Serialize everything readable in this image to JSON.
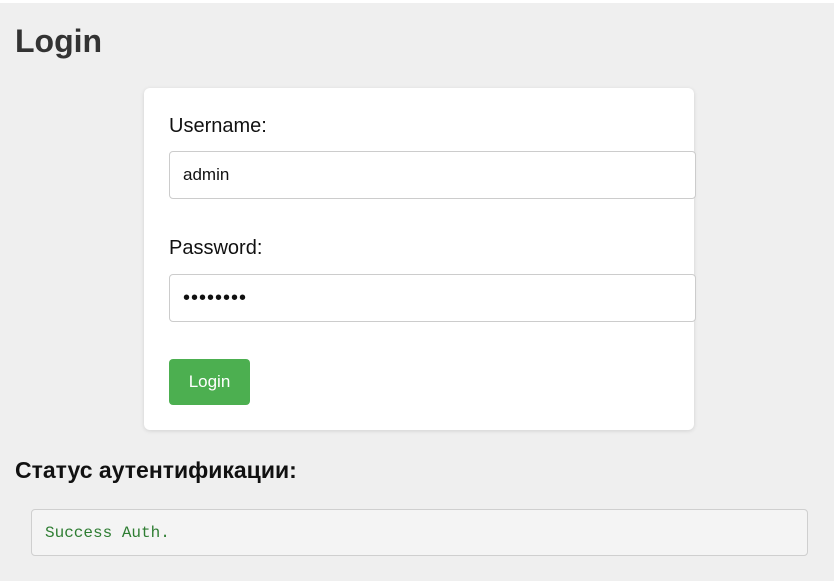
{
  "page": {
    "title": "Login"
  },
  "form": {
    "username_label": "Username:",
    "username_value": "admin",
    "password_label": "Password:",
    "password_value": "••••••••",
    "submit_label": "Login"
  },
  "status": {
    "heading": "Статус аутентификации:",
    "message": "Success Auth.",
    "message_color": "#2e7d32"
  },
  "colors": {
    "background": "#efefef",
    "card": "#ffffff",
    "accent": "#4caf50"
  }
}
